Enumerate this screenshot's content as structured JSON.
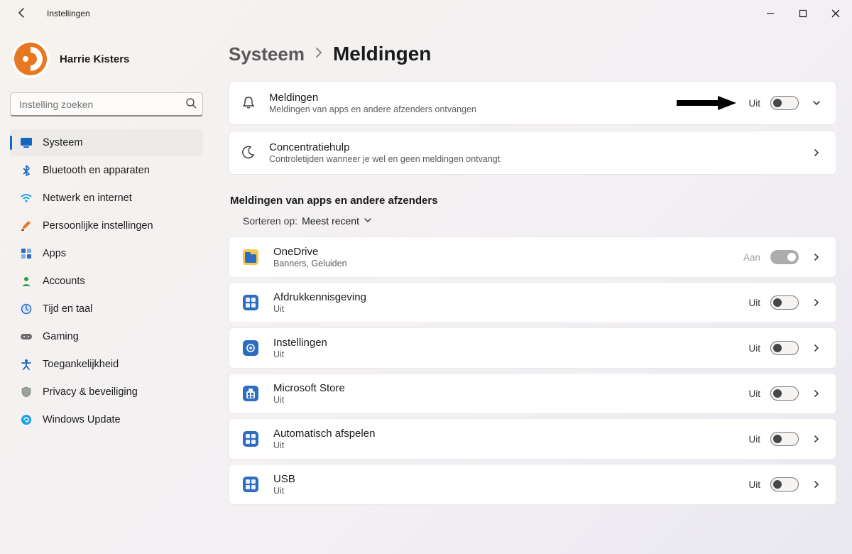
{
  "window": {
    "title": "Instellingen"
  },
  "profile": {
    "name": "Harrie Kisters"
  },
  "search": {
    "placeholder": "Instelling zoeken"
  },
  "sidebar": {
    "items": [
      {
        "label": "Systeem"
      },
      {
        "label": "Bluetooth en apparaten"
      },
      {
        "label": "Netwerk en internet"
      },
      {
        "label": "Persoonlijke instellingen"
      },
      {
        "label": "Apps"
      },
      {
        "label": "Accounts"
      },
      {
        "label": "Tijd en taal"
      },
      {
        "label": "Gaming"
      },
      {
        "label": "Toegankelijkheid"
      },
      {
        "label": "Privacy & beveiliging"
      },
      {
        "label": "Windows Update"
      }
    ]
  },
  "breadcrumb": {
    "parent": "Systeem",
    "current": "Meldingen"
  },
  "cards": {
    "notifications": {
      "title": "Meldingen",
      "subtitle": "Meldingen van apps en andere afzenders ontvangen",
      "state": "Uit"
    },
    "focus": {
      "title": "Concentratiehulp",
      "subtitle": "Controletijden wanneer je wel en geen meldingen ontvangt"
    }
  },
  "appSection": {
    "heading": "Meldingen van apps en andere afzenders",
    "sortLabel": "Sorteren op:",
    "sortValue": "Meest recent"
  },
  "apps": [
    {
      "title": "OneDrive",
      "subtitle": "Banners, Geluiden",
      "state": "Aan",
      "icon": "onedrive"
    },
    {
      "title": "Afdrukkennisgeving",
      "subtitle": "Uit",
      "state": "Uit",
      "icon": "generic"
    },
    {
      "title": "Instellingen",
      "subtitle": "Uit",
      "state": "Uit",
      "icon": "settings"
    },
    {
      "title": "Microsoft Store",
      "subtitle": "Uit",
      "state": "Uit",
      "icon": "store"
    },
    {
      "title": "Automatisch afspelen",
      "subtitle": "Uit",
      "state": "Uit",
      "icon": "generic"
    },
    {
      "title": "USB",
      "subtitle": "Uit",
      "state": "Uit",
      "icon": "generic"
    }
  ],
  "colors": {
    "accent": "#1566c0",
    "orange": "#e87722",
    "blue": "#2e6cc1"
  }
}
